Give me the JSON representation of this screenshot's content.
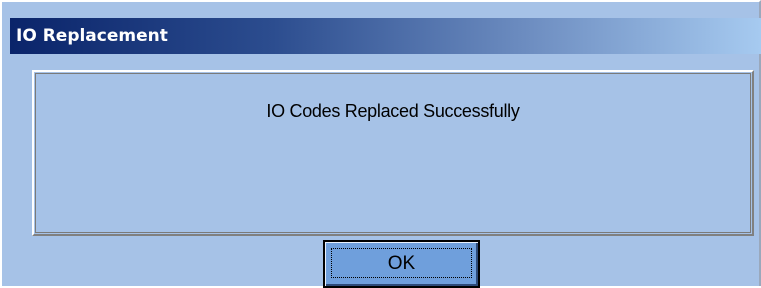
{
  "window": {
    "title": "IO Replacement"
  },
  "message": {
    "text": "IO Codes Replaced Successfully"
  },
  "buttons": {
    "ok_label": "OK"
  },
  "colors": {
    "dialog_background": "#a6c2e7",
    "titlebar_start": "#0a246a",
    "titlebar_end": "#a6caf0",
    "button_face": "#6f9fdc"
  }
}
